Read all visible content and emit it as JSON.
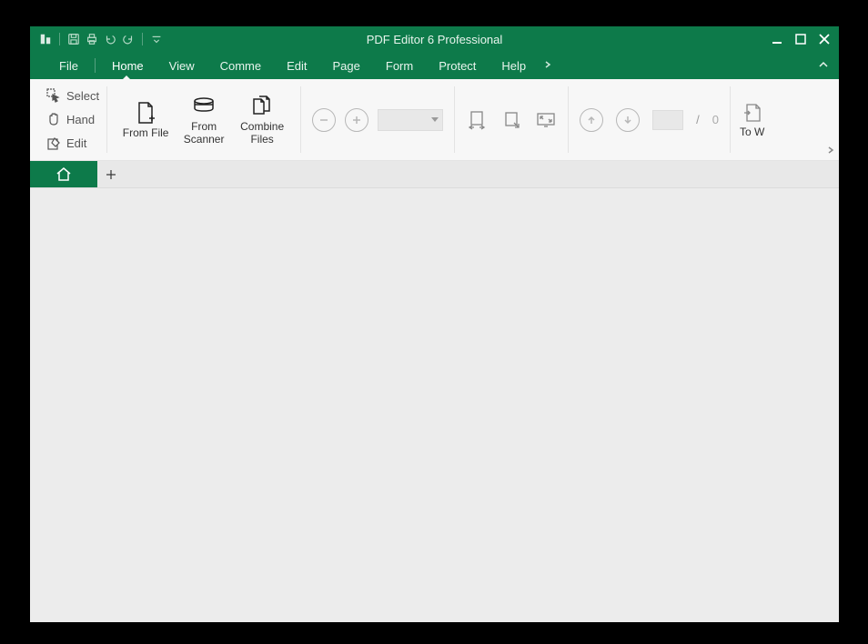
{
  "app": {
    "title": "PDF Editor 6 Professional"
  },
  "menu": {
    "items": [
      "File",
      "Home",
      "View",
      "Comme",
      "Edit",
      "Page",
      "Form",
      "Protect",
      "Help"
    ],
    "active_index": 1
  },
  "tools": {
    "select": "Select",
    "hand": "Hand",
    "edit": "Edit"
  },
  "create": {
    "from_file": "From File",
    "from_scanner": "From\nScanner",
    "combine": "Combine\nFiles"
  },
  "zoom": {
    "value": ""
  },
  "page": {
    "current": "",
    "separator": "/",
    "total": "0"
  },
  "export": {
    "to_word": "To W"
  },
  "colors": {
    "brand": "#0d7a4a"
  }
}
